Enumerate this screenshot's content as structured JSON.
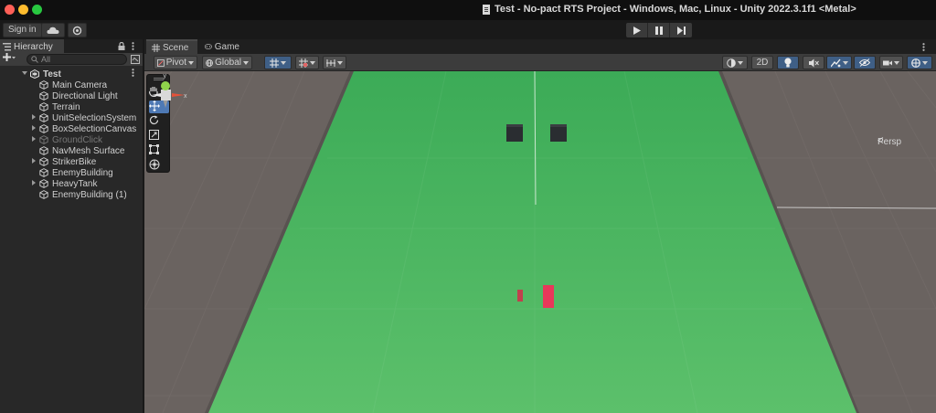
{
  "window": {
    "title": "Test - No-pact RTS Project - Windows, Mac, Linux - Unity 2022.3.1f1 <Metal>"
  },
  "toolbar": {
    "signin_label": "Sign in",
    "icons": [
      "cloud-icon",
      "settings-icon",
      "play-icon",
      "pause-icon",
      "step-icon"
    ]
  },
  "hierarchy": {
    "tab_label": "Hierarchy",
    "search_placeholder": "All",
    "scene_name": "Test",
    "items": [
      {
        "label": "Main Camera",
        "expandable": false,
        "inactive": false
      },
      {
        "label": "Directional Light",
        "expandable": false,
        "inactive": false
      },
      {
        "label": "Terrain",
        "expandable": false,
        "inactive": false
      },
      {
        "label": "UnitSelectionSystem",
        "expandable": true,
        "inactive": false
      },
      {
        "label": "BoxSelectionCanvas",
        "expandable": true,
        "inactive": false
      },
      {
        "label": "GroundClick",
        "expandable": true,
        "inactive": true
      },
      {
        "label": "NavMesh Surface",
        "expandable": false,
        "inactive": false
      },
      {
        "label": "StrikerBike",
        "expandable": true,
        "inactive": false
      },
      {
        "label": "EnemyBuilding",
        "expandable": false,
        "inactive": false
      },
      {
        "label": "HeavyTank",
        "expandable": true,
        "inactive": false
      },
      {
        "label": "EnemyBuilding (1)",
        "expandable": false,
        "inactive": false
      }
    ]
  },
  "scene": {
    "tabs": [
      {
        "label": "Scene",
        "active": true
      },
      {
        "label": "Game",
        "active": false
      }
    ],
    "pivot_label": "Pivot",
    "global_label": "Global",
    "mode_2d_label": "2D",
    "persp_label": "Persp",
    "colors": {
      "ground": "#3cab57",
      "ground_near": "#5cc06b",
      "outside": "#6a6360",
      "building": "#2a2d31",
      "unit": "#e8385a",
      "unit_small": "#c0414d",
      "active_tool": "#4e79b4"
    }
  }
}
